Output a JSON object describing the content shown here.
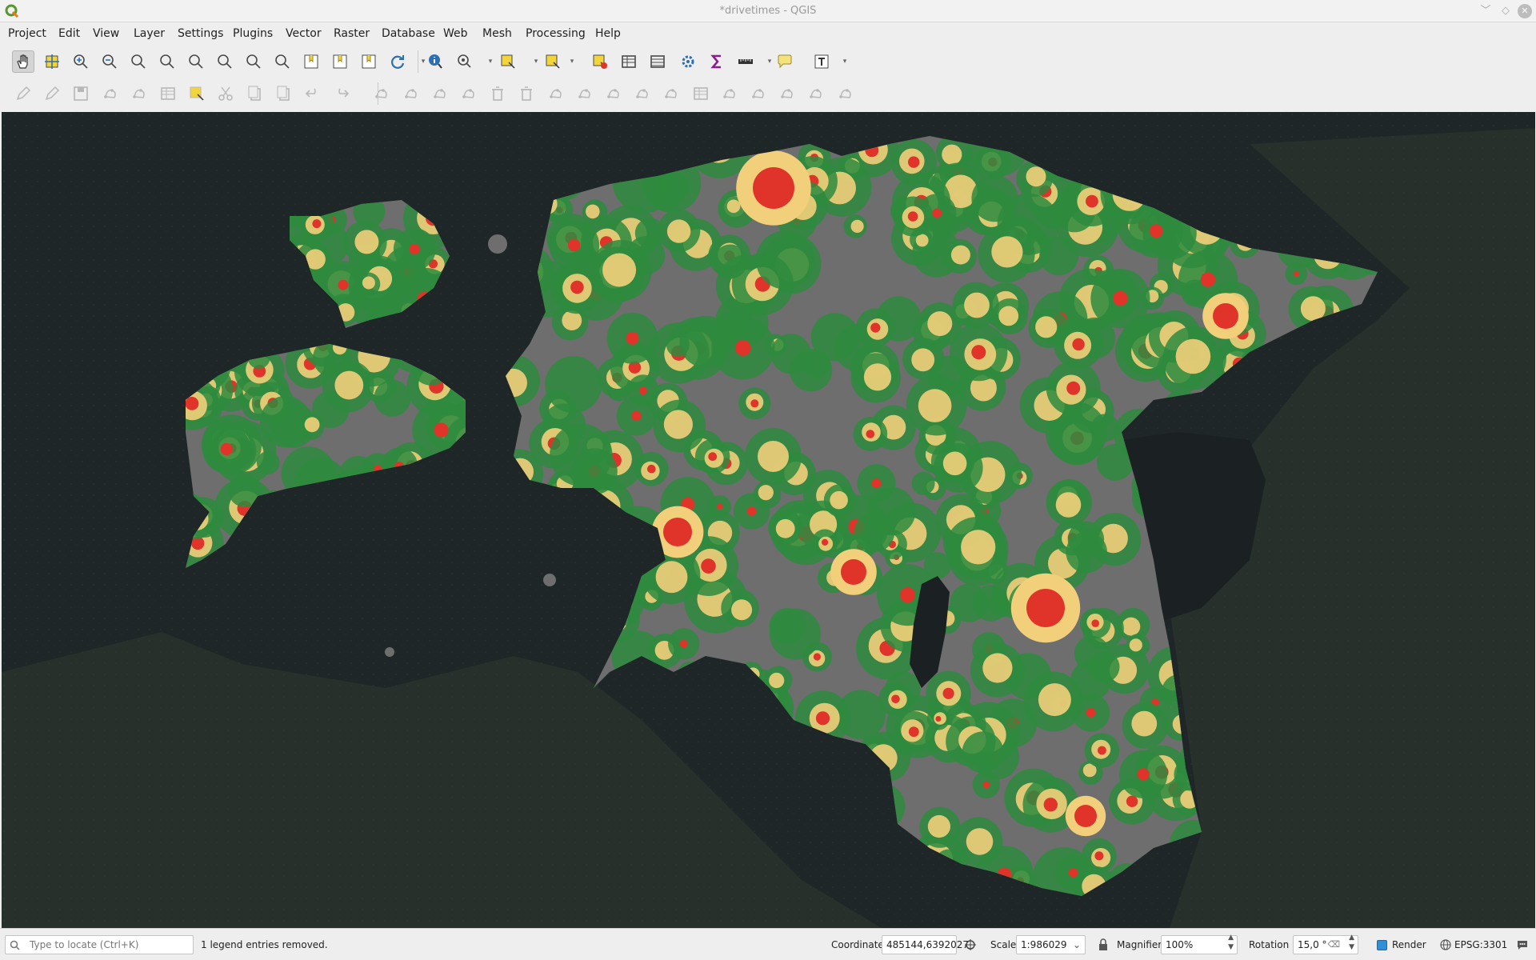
{
  "window": {
    "title": "*drivetimes - QGIS"
  },
  "menu": [
    "Project",
    "Edit",
    "View",
    "Layer",
    "Settings",
    "Plugins",
    "Vector",
    "Raster",
    "Database",
    "Web",
    "Mesh",
    "Processing",
    "Help"
  ],
  "toolbar1": [
    {
      "icon": "pan-hand-icon",
      "active": true
    },
    {
      "icon": "pan-to-selection-icon"
    },
    {
      "icon": "zoom-in-icon"
    },
    {
      "icon": "zoom-out-icon"
    },
    {
      "icon": "zoom-native-resolution-icon"
    },
    {
      "icon": "zoom-full-icon"
    },
    {
      "icon": "zoom-to-selection-icon"
    },
    {
      "icon": "zoom-to-layer-icon"
    },
    {
      "icon": "zoom-last-icon"
    },
    {
      "icon": "zoom-next-icon"
    },
    {
      "icon": "new-map-view-icon"
    },
    {
      "icon": "new-bookmark-icon"
    },
    {
      "icon": "show-bookmarks-icon"
    },
    {
      "icon": "refresh-icon"
    },
    {
      "icon": "identify-features-icon"
    },
    {
      "icon": "run-feature-action-icon"
    },
    {
      "icon": "select-features-icon"
    },
    {
      "icon": "select-by-value-icon"
    },
    {
      "icon": "deselect-all-icon"
    },
    {
      "icon": "attribute-table-icon"
    },
    {
      "icon": "field-calculator-icon"
    },
    {
      "icon": "toolbox-gear-icon"
    },
    {
      "icon": "statistics-sigma-icon"
    },
    {
      "icon": "measure-line-icon"
    },
    {
      "icon": "map-tips-icon"
    },
    {
      "icon": "text-annotation-icon"
    }
  ],
  "toolbar2": [
    "current-edits-icon",
    "toggle-editing-icon",
    "save-edits-icon",
    "add-feature-icon",
    "vertex-tool-icon",
    "modify-attributes-icon",
    "delete-selected-icon",
    "cut-features-icon",
    "copy-features-icon",
    "paste-features-icon",
    "undo-icon",
    "redo-icon",
    "digitize-shape-icon",
    "add-ring-icon",
    "add-part-icon",
    "fill-ring-icon",
    "delete-ring-icon",
    "delete-part-icon",
    "reshape-icon",
    "offset-curve-icon",
    "split-features-icon",
    "split-parts-icon",
    "merge-features-icon",
    "merge-attributes-icon",
    "rotate-point-icon",
    "simplify-icon",
    "reverse-line-icon",
    "trim-extend-icon",
    "rotate-feature-icon"
  ],
  "status": {
    "locate_placeholder": "Type to locate (Ctrl+K)",
    "message": "1 legend entries removed.",
    "coordinate_label": "Coordinate",
    "coordinate_value": "485144,6392027",
    "scale_label": "Scale",
    "scale_value": "1:986029",
    "magnifier_label": "Magnifier",
    "magnifier_value": "100%",
    "rotation_label": "Rotation",
    "rotation_value": "15,0 °",
    "render_label": "Render",
    "crs_label": "EPSG:3301"
  },
  "map_colors": {
    "water": "#1f2628",
    "land_outside": "#2a3226",
    "isochrone_base": "#6e6e6e",
    "zone_green": "#2e8b3e",
    "zone_yellow": "#f2cf7a",
    "zone_red": "#e0332a"
  }
}
